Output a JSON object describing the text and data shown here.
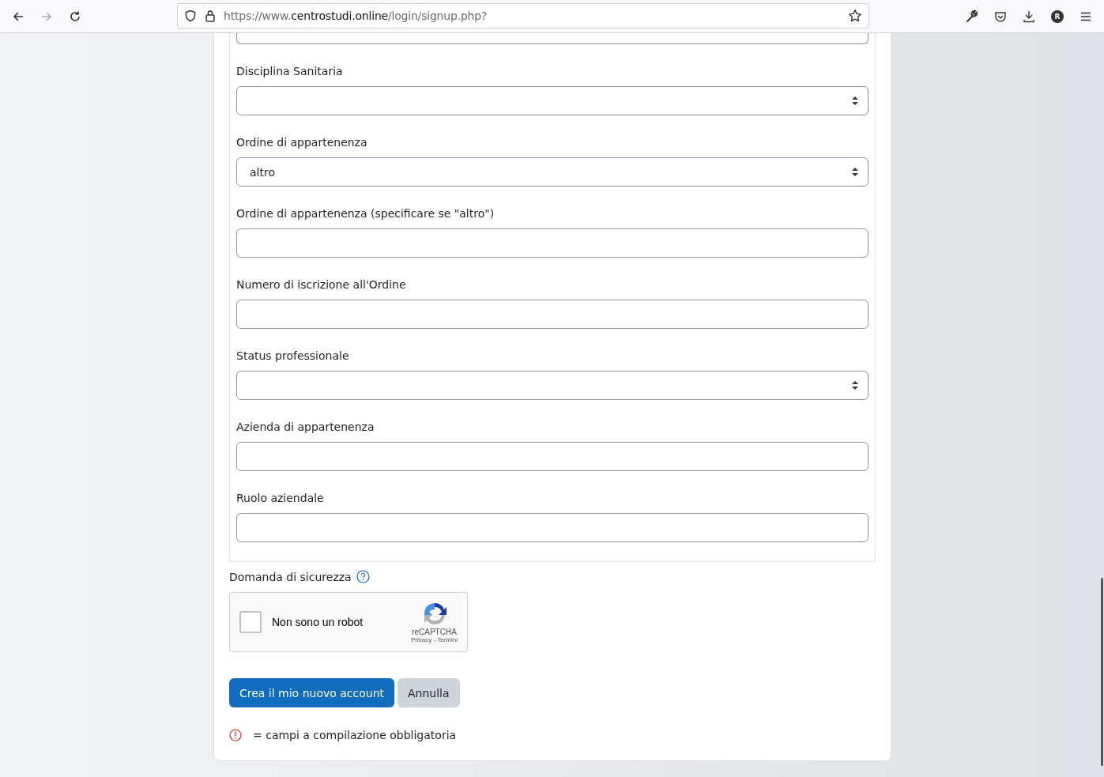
{
  "browser": {
    "url": {
      "scheme": "https://www.",
      "domain": "centrostudi.online",
      "path": "/login/signup.php?"
    },
    "account_initial": "R"
  },
  "form": {
    "fields": [
      {
        "kind": "select",
        "label": "Disciplina Sanitaria"
      },
      {
        "kind": "select",
        "label": "Ordine di appartenenza",
        "value": "altro"
      },
      {
        "kind": "text",
        "label": "Ordine di appartenenza (specificare se \"altro\")"
      },
      {
        "kind": "text",
        "label": "Numero di iscrizione all'Ordine"
      },
      {
        "kind": "select",
        "label": "Status professionale"
      },
      {
        "kind": "text",
        "label": "Azienda di appartenenza"
      },
      {
        "kind": "text",
        "label": "Ruolo aziendale"
      }
    ],
    "security_label": "Domanda di sicurezza",
    "captcha": {
      "checked": false,
      "label": "Non sono un robot",
      "brand": "reCAPTCHA",
      "privacy": "Privacy",
      "separator": "-",
      "terms": "Termini"
    },
    "buttons": [
      {
        "kind": "primary",
        "label": "Crea il mio nuovo account"
      },
      {
        "kind": "secondary",
        "label": "Annulla"
      }
    ],
    "required_note": "= campi a compilazione obbligatoria"
  }
}
